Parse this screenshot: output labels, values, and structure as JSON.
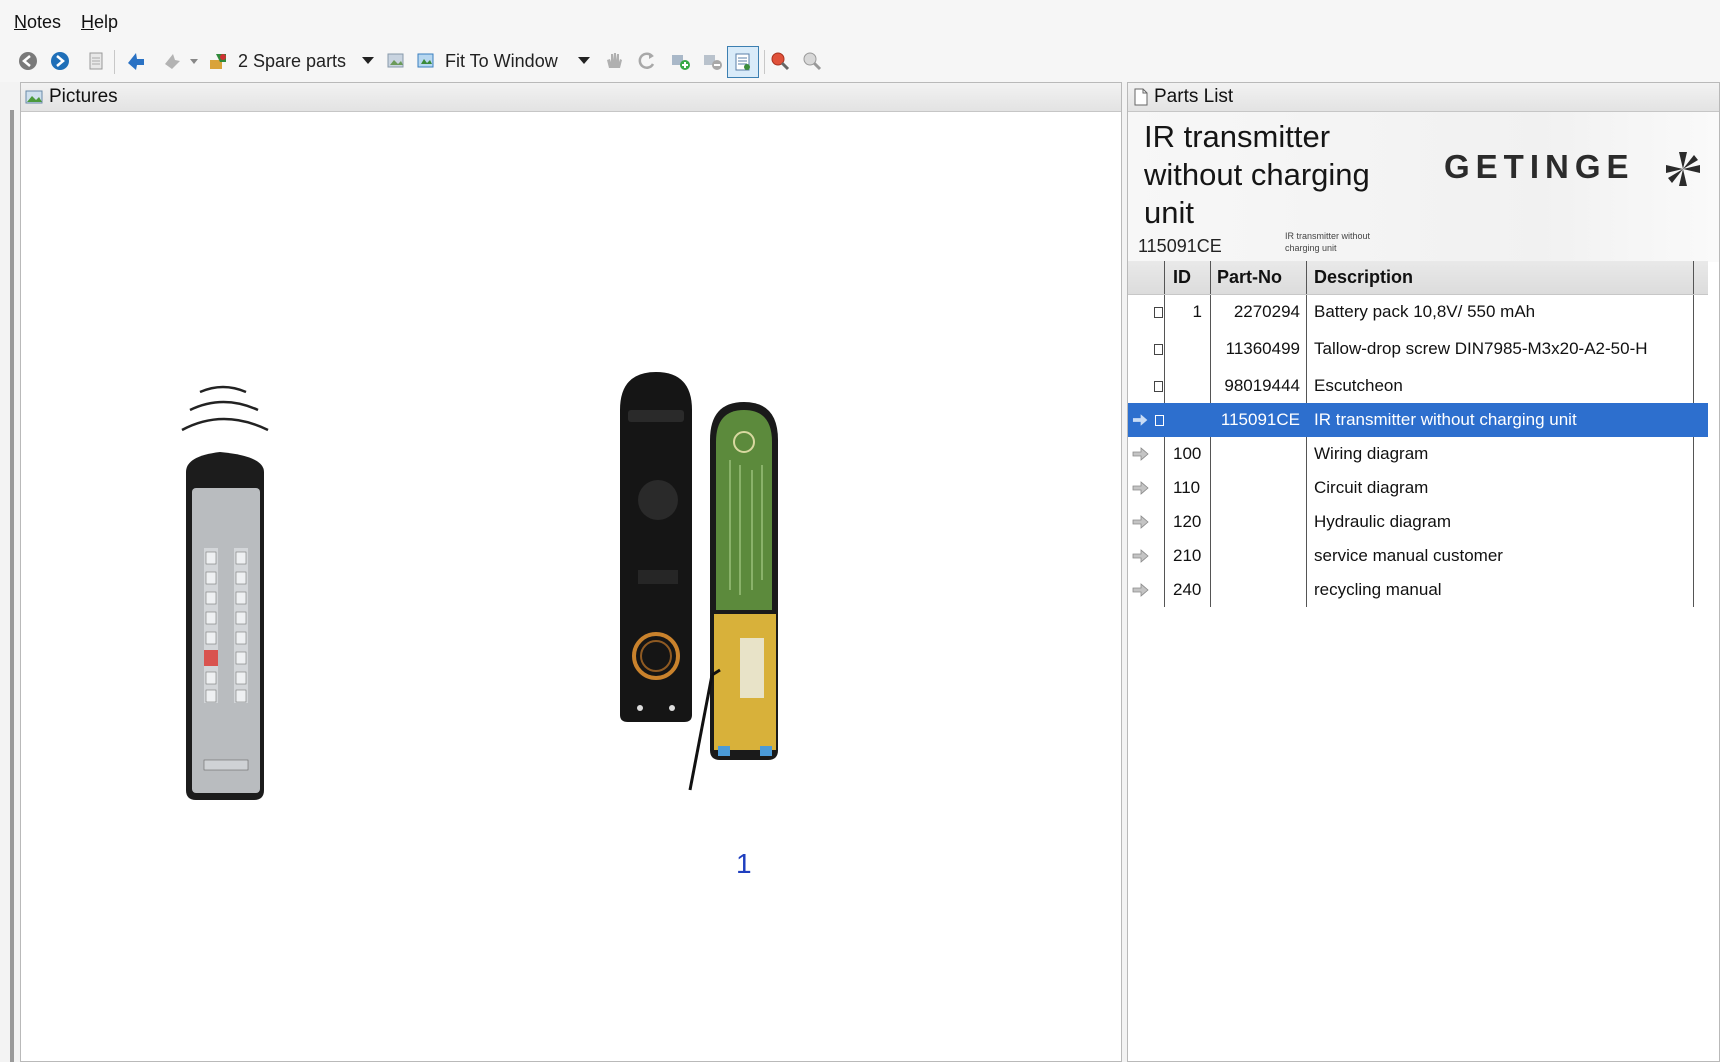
{
  "menu": {
    "notes": "Notes",
    "help": "Help"
  },
  "toolbar": {
    "spare_parts_label": "2 Spare parts",
    "zoom_label": "Fit To Window"
  },
  "pictures_pane": {
    "title": "Pictures",
    "callout": "1"
  },
  "parts_pane": {
    "title": "Parts List",
    "doc_title": "IR transmitter without charging unit",
    "doc_code": "115091CE",
    "doc_small": "IR transmitter without charging unit",
    "brand": "GETINGE"
  },
  "table": {
    "headers": {
      "id": "ID",
      "part_no": "Part-No",
      "description": "Description"
    },
    "rows": [
      {
        "id": "1",
        "part_no": "2270294",
        "description": "Battery pack 10,8V/ 550 mAh"
      },
      {
        "id": "",
        "part_no": "11360499",
        "description": "Tallow-drop screw DIN7985-M3x20-A2-50-H"
      },
      {
        "id": "",
        "part_no": "98019444",
        "description": "Escutcheon"
      },
      {
        "id": "",
        "part_no": "115091CE",
        "description": "IR transmitter without charging unit"
      },
      {
        "id": "100",
        "part_no": "",
        "description": "Wiring diagram"
      },
      {
        "id": "110",
        "part_no": "",
        "description": "Circuit diagram"
      },
      {
        "id": "120",
        "part_no": "",
        "description": "Hydraulic diagram"
      },
      {
        "id": "210",
        "part_no": "",
        "description": "service manual customer"
      },
      {
        "id": "240",
        "part_no": "",
        "description": "recycling manual"
      }
    ]
  },
  "colors": {
    "selection": "#2d6fce",
    "callout": "#1f3fbf"
  }
}
